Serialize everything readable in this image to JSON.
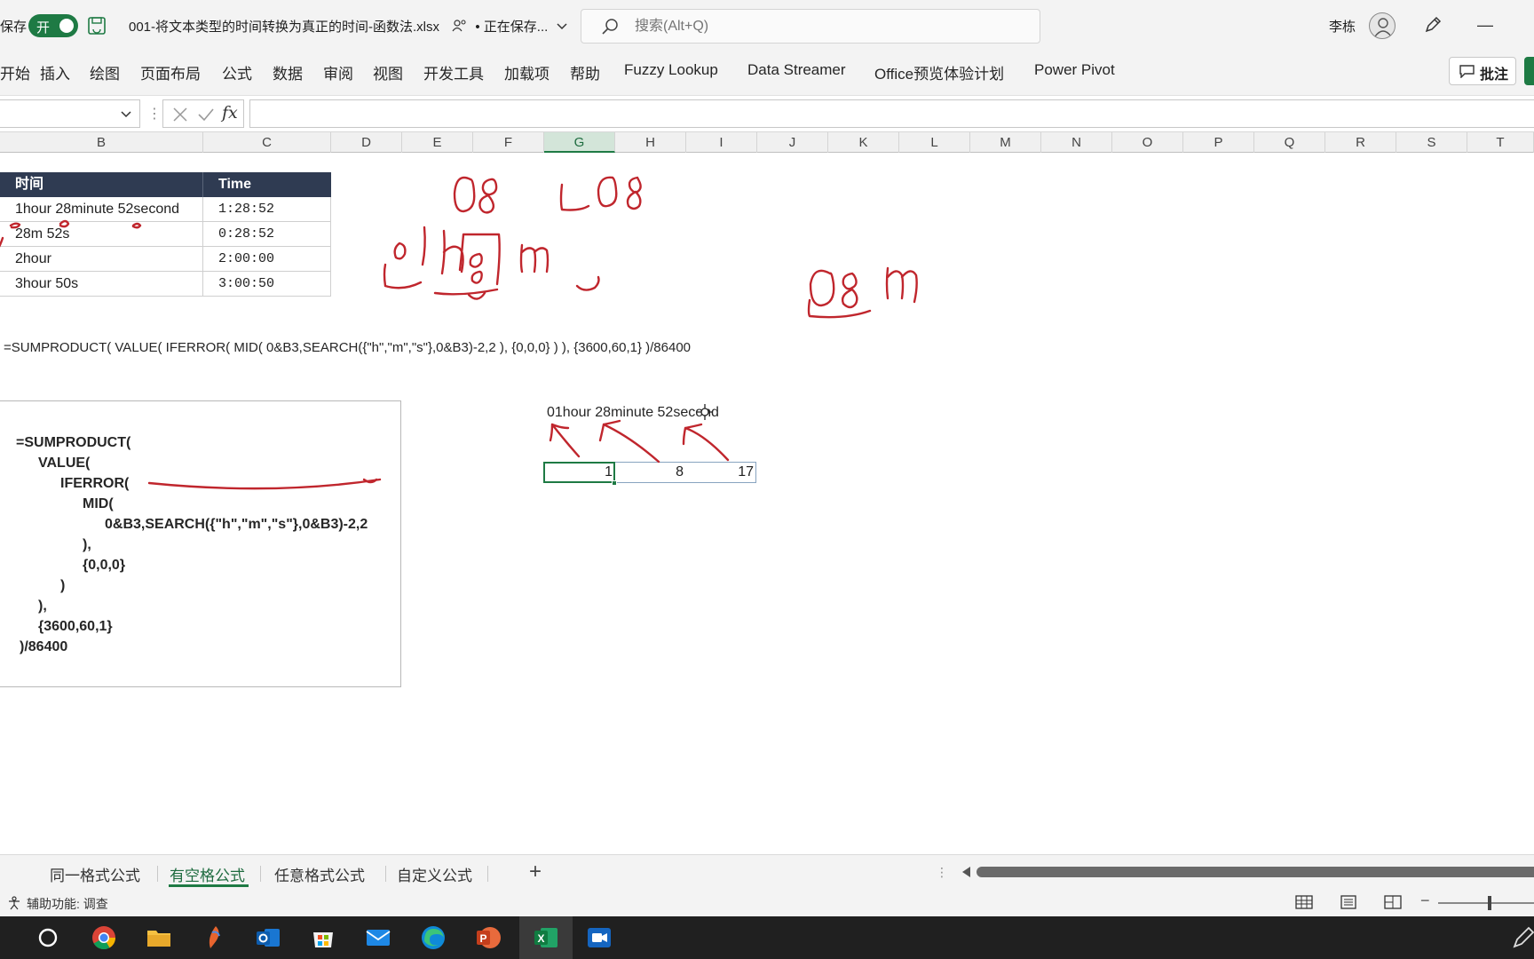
{
  "titlebar": {
    "autosave_label": "保存",
    "toggle_label": "开",
    "document_title": "001-将文本类型的时间转换为真正的时间-函数法.xlsx",
    "save_status": "• 正在保存...",
    "search_placeholder": "搜索(Alt+Q)",
    "user_name": "李栋",
    "minimize_glyph": "—"
  },
  "ribbon": {
    "tabs": [
      "开始",
      "插入",
      "绘图",
      "页面布局",
      "公式",
      "数据",
      "审阅",
      "视图",
      "开发工具",
      "加载项",
      "帮助",
      "Fuzzy Lookup",
      "Data Streamer",
      "Office预览体验计划",
      "Power Pivot"
    ],
    "comment_button": "批注"
  },
  "formula_bar": {
    "fx": "fx",
    "value": ""
  },
  "columns": [
    "B",
    "C",
    "D",
    "E",
    "F",
    "G",
    "H",
    "I",
    "J",
    "K",
    "L",
    "M",
    "N",
    "O",
    "P",
    "Q",
    "R",
    "S",
    "T"
  ],
  "table": {
    "headers": [
      "时间",
      "Time"
    ],
    "rows": [
      [
        "1hour 28minute 52second",
        "1:28:52"
      ],
      [
        "28m 52s",
        "0:28:52"
      ],
      [
        "2hour",
        "2:00:00"
      ],
      [
        "3hour 50s",
        "3:00:50"
      ]
    ]
  },
  "formula_line": "=SUMPRODUCT( VALUE( IFERROR( MID( 0&B3,SEARCH({\"h\",\"m\",\"s\"},0&B3)-2,2 ), {0,0,0} ) ), {3600,60,1} )/86400",
  "formula_box_lines": [
    "=SUMPRODUCT(",
    "VALUE(",
    "IFERROR(",
    "MID(",
    "0&B3,SEARCH({\"h\",\"m\",\"s\"},0&B3)-2,2",
    "),",
    "{0,0,0}",
    ")",
    "),",
    "{3600,60,1}",
    ")/86400"
  ],
  "demo_text": "01hour 28minute 52second",
  "demo_values": [
    "1",
    "8",
    "17"
  ],
  "sheet_tabs": [
    "同一格式公式",
    "有空格公式",
    "任意格式公式",
    "自定义公式"
  ],
  "active_sheet": "有空格公式",
  "add_sheet_glyph": "+",
  "status": {
    "accessibility": "辅助功能: 调查"
  },
  "colors": {
    "excel_green": "#1e7a44",
    "table_header_bg": "#2f3b52",
    "ink_red": "#c0262d"
  },
  "taskbar_icons": [
    "start-circle-icon",
    "chrome-icon",
    "file-explorer-icon",
    "feather-app-icon",
    "outlook-icon",
    "store-icon",
    "mail-icon",
    "edge-icon",
    "powerpoint-icon",
    "excel-icon",
    "video-app-icon"
  ]
}
